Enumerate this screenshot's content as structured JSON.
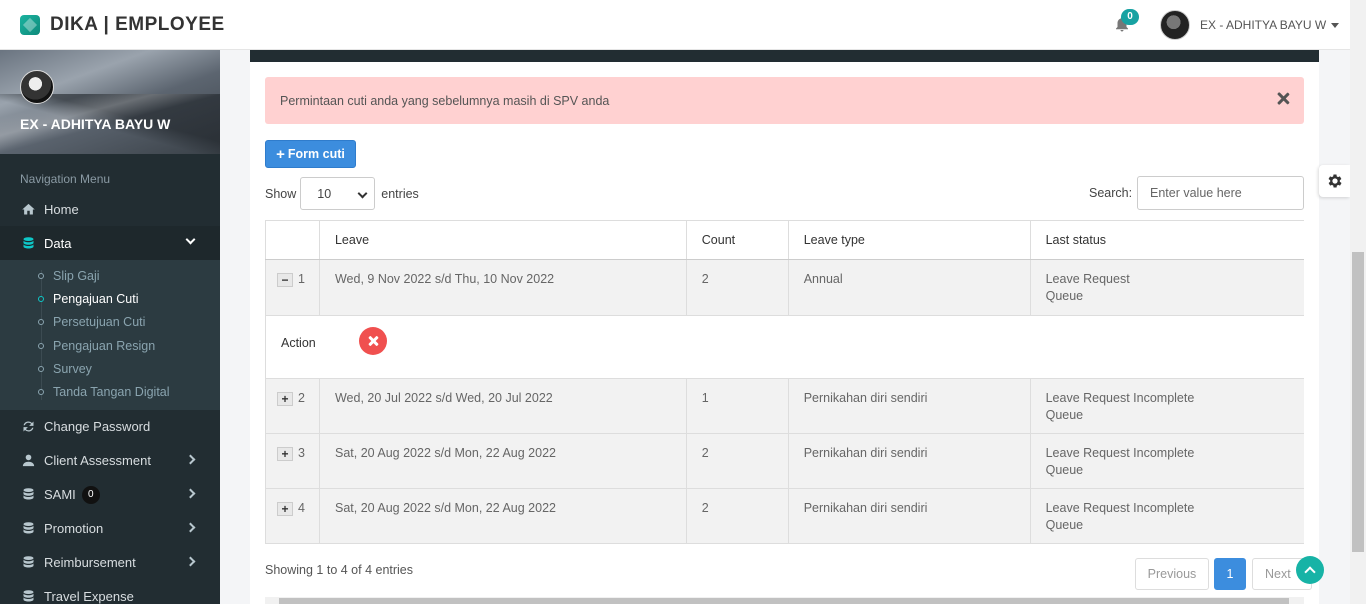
{
  "app": {
    "title": "DIKA | EMPLOYEE",
    "notification_count": "0",
    "user_name": "EX - ADHITYA BAYU W"
  },
  "sidebar": {
    "profile_name": "EX - ADHITYA BAYU W",
    "header": "Navigation Menu",
    "home": "Home",
    "data": "Data",
    "sub_items": [
      "Slip Gaji",
      "Pengajuan Cuti",
      "Persetujuan Cuti",
      "Pengajuan Resign",
      "Survey",
      "Tanda Tangan Digital"
    ],
    "change_password": "Change Password",
    "client_assessment": "Client Assessment",
    "sami": "SAMI",
    "sami_count": "0",
    "promotion": "Promotion",
    "reimbursement": "Reimbursement",
    "travel_expense": "Travel Expense"
  },
  "alert": {
    "message": "Permintaan cuti anda yang sebelumnya masih di SPV anda"
  },
  "toolbar": {
    "form_button": "Form cuti",
    "show_label": "Show",
    "entries_value": "10",
    "entries_label": "entries",
    "search_label": "Search:",
    "search_placeholder": "Enter value here"
  },
  "table": {
    "headers": [
      "",
      "Leave",
      "Count",
      "Leave type",
      "Last status"
    ],
    "rows": [
      {
        "no": "1",
        "leave": "Wed, 9 Nov 2022 s/d Thu, 10 Nov 2022",
        "count": "2",
        "type": "Annual",
        "status_1": "Leave Request",
        "status_2": "Queue",
        "expanded": true
      },
      {
        "no": "2",
        "leave": "Wed, 20 Jul 2022 s/d Wed, 20 Jul 2022",
        "count": "1",
        "type": "Pernikahan diri sendiri",
        "status_1": "Leave Request Incomplete",
        "status_2": "Queue"
      },
      {
        "no": "3",
        "leave": "Sat, 20 Aug 2022 s/d Mon, 22 Aug 2022",
        "count": "2",
        "type": "Pernikahan diri sendiri",
        "status_1": "Leave Request Incomplete",
        "status_2": "Queue"
      },
      {
        "no": "4",
        "leave": "Sat, 20 Aug 2022 s/d Mon, 22 Aug 2022",
        "count": "2",
        "type": "Pernikahan diri sendiri",
        "status_1": "Leave Request Incomplete",
        "status_2": "Queue"
      }
    ],
    "action_label": "Action",
    "expand_symbol": "+",
    "collapse_symbol": "−"
  },
  "footer": {
    "showing": "Showing 1 to 4 of 4 entries",
    "previous": "Previous",
    "page": "1",
    "next": "Next"
  },
  "colors": {
    "accent": "#3c8dde",
    "sidebar_bg": "#222d32",
    "alert_bg": "#ffd1d1",
    "teal": "#17b3a6",
    "danger": "#f0504f"
  }
}
